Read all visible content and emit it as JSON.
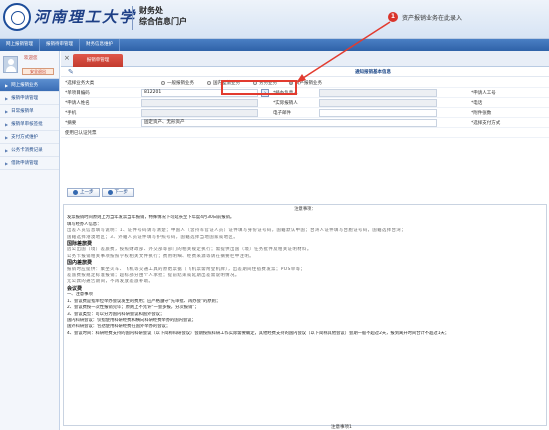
{
  "header": {
    "logo_text": "河南理工大学",
    "dept": "财务处",
    "portal": "综合信息门户",
    "notify_count": "1",
    "notify_text": "资产报销业务在此录入"
  },
  "topnav": [
    "网上报销管理",
    "报销待审管理",
    "财务信息维护"
  ],
  "sidebar": {
    "welcome": "欢迎您",
    "name": "",
    "logout": "安全退出",
    "items": [
      "网上报销业务",
      "报销申请管理",
      "日常报销单",
      "报销单审核签批",
      "支付方式维护",
      "公务卡消费记录",
      "借款申请管理"
    ]
  },
  "tab": {
    "label": "报销单管理"
  },
  "form": {
    "title": "通知报销基本信息",
    "biz_type_label": "*选择业务大类",
    "biz_types": [
      "一般报销业务",
      "国内差旅业务",
      "劳务业务",
      "资产报销业务"
    ],
    "biz_selected": 3,
    "project_no_label": "*单项目编码",
    "project_no": "812201",
    "manager_label": "*经办负责人",
    "manager_value": "",
    "applicant_label": "*申请人工号",
    "applicant_name_label": "*申请人姓名",
    "actual_payer_label": "*实际报销人",
    "phone_label": "*电话",
    "mobile_label": "*手机",
    "email_label": "电子邮件",
    "attachments_label": "*附件张数",
    "summary_label": "*摘要",
    "summary_value": "固定资产、无形资产",
    "pay_method_label": "*选择支付方式",
    "voucher_label": "使用已认证凭票"
  },
  "buttons": {
    "prev": "上一步",
    "next": "下一步"
  },
  "notice": {
    "heading": "注意事项：",
    "paras": [
      "发票报销时间原则上为当年发票当年报销，特殊情况下可延长至下年度4月30日前报销。",
      "填写经办人信息：",
      "出差人员信息填写说明：1、证件号码请写清楚；中国人（含持军官证人员）证件填写身份证号码，国籍默认中国；台湾人证件填写台胞证号码，国籍选择台湾；",
      "国籍选择港澳地区；3、外籍人员证件填写护照号码，国籍选择当地国家或地区。"
    ],
    "sec1": "国际差旅费",
    "sec1_paras": [
      "因公出国（境）差旅费，按照财政部、外交部等部门的相关规定执行；需提供出国（境）任务批件及相关证明材料。",
      "公务卡报销相关事项按照学校相关文件执行；费用明细、经费来源等请在摘要栏中注明。"
    ],
    "sec2": "国内差旅费",
    "sec2_paras": [
      "报销时应提供：乘坐火车、飞机等交通工具的原始票据（飞机票需附登机牌），出差期间住宿费发票；POS单等；",
      "差旅费按规定标准报销；超标部分由个人承担；提前结束或延期出差需说明情况。",
      "无公款的通告期间，不再发放差旅补助。"
    ],
    "sec3": "会议费",
    "sec3_paras": [
      "一、注意事项",
      "1、会议费是指单位举办会议发生的费用；应严格遵守“先审批、再办会”的原则；",
      "2、会议费按一次性报销完毕；原则上不允许“一会多报，分次报销”；",
      "3、会议类型：可以分为国内科研会议和国外会议；",
      "国内科研会议：仅指使用科研经费和横向科研经费举办的国内会议；",
      "国外科研会议：包括使用科研经费在国外举办的会议；",
      "4、会议时间：科研经费支持的国内科研会议（以下简称科研会议）会期按照科研工作实际需要确定，其他经费支持的国内会议（以下简称其他会议）会期一般不超过2天，报到离开时间合计不超过1天；"
    ],
    "footer": "注意事项1"
  }
}
